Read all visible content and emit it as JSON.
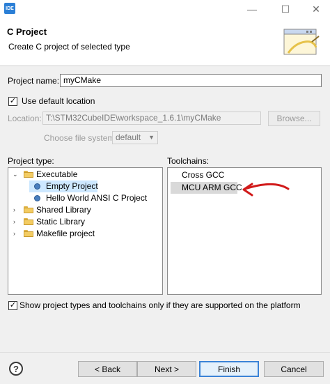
{
  "titlebar": {
    "app_icon_text": "IDE",
    "minimize": "—",
    "maximize": "☐",
    "close": "✕"
  },
  "header": {
    "title": "C Project",
    "description": "Create C project of selected type"
  },
  "project_name": {
    "label": "Project name:",
    "value": "myCMake"
  },
  "use_default_location": {
    "label": "Use default location",
    "checked": true
  },
  "location": {
    "label": "Location:",
    "value": "T:\\STM32CubeIDE\\workspace_1.6.1\\myCMake",
    "browse_label": "Browse..."
  },
  "file_system": {
    "label": "Choose file system:",
    "value": "default"
  },
  "project_type": {
    "label": "Project type:",
    "items": [
      {
        "label": "Executable",
        "kind": "folder",
        "expanded": true,
        "level": 0
      },
      {
        "label": "Empty Project",
        "kind": "project",
        "level": 1,
        "selected": true
      },
      {
        "label": "Hello World ANSI C Project",
        "kind": "project",
        "level": 1
      },
      {
        "label": "Shared Library",
        "kind": "folder",
        "expanded": false,
        "level": 0
      },
      {
        "label": "Static Library",
        "kind": "folder",
        "expanded": false,
        "level": 0
      },
      {
        "label": "Makefile project",
        "kind": "folder",
        "expanded": false,
        "level": 0
      }
    ]
  },
  "toolchains": {
    "label": "Toolchains:",
    "items": [
      {
        "label": "Cross GCC"
      },
      {
        "label": "MCU ARM GCC",
        "selected": true
      }
    ]
  },
  "show_supported": {
    "label": "Show project types and toolchains only if they are supported on the platform",
    "checked": true
  },
  "footer": {
    "help": "?",
    "back": "< Back",
    "next": "Next >",
    "finish": "Finish",
    "cancel": "Cancel"
  },
  "colors": {
    "annotation_arrow": "#d11a1a",
    "selection": "#cde8ff",
    "primary_border": "#3b83d6"
  }
}
